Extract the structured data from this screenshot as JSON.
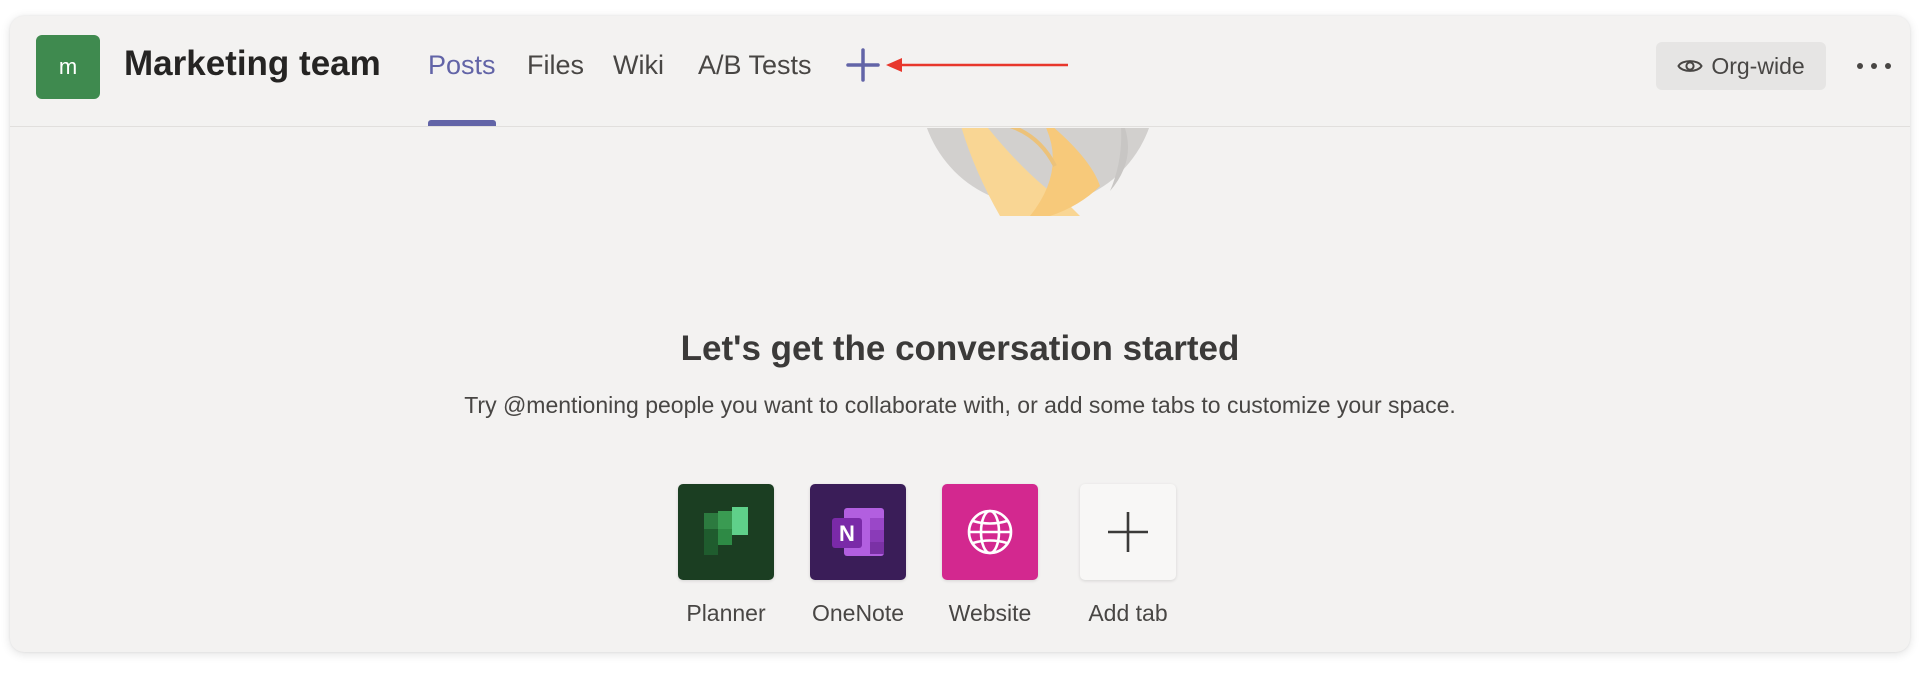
{
  "header": {
    "team_avatar_initial": "m",
    "team_name": "Marketing team",
    "tabs": [
      {
        "label": "Posts",
        "active": true
      },
      {
        "label": "Files",
        "active": false
      },
      {
        "label": "Wiki",
        "active": false
      },
      {
        "label": "A/B Tests",
        "active": false
      }
    ],
    "add_tab_icon": "plus-icon",
    "annotation_arrow_color": "#e8372c",
    "privacy_label": "Org-wide",
    "privacy_icon": "eye-icon",
    "more_icon": "more-options-icon"
  },
  "empty_state": {
    "title": "Let's get the conversation started",
    "subtitle": "Try @mentioning people you want to collaborate with, or add some tabs to customize your space."
  },
  "apps": [
    {
      "label": "Planner",
      "icon": "planner-icon",
      "color": "#1b3e22"
    },
    {
      "label": "OneNote",
      "icon": "onenote-icon",
      "color": "#3a1d58"
    },
    {
      "label": "Website",
      "icon": "globe-icon",
      "color": "#d3288f"
    },
    {
      "label": "Add tab",
      "icon": "plus-icon",
      "color": "#f8f7f6"
    }
  ],
  "colors": {
    "accent": "#6264a7",
    "team_avatar": "#3f8a4f",
    "background": "#f3f2f1"
  }
}
